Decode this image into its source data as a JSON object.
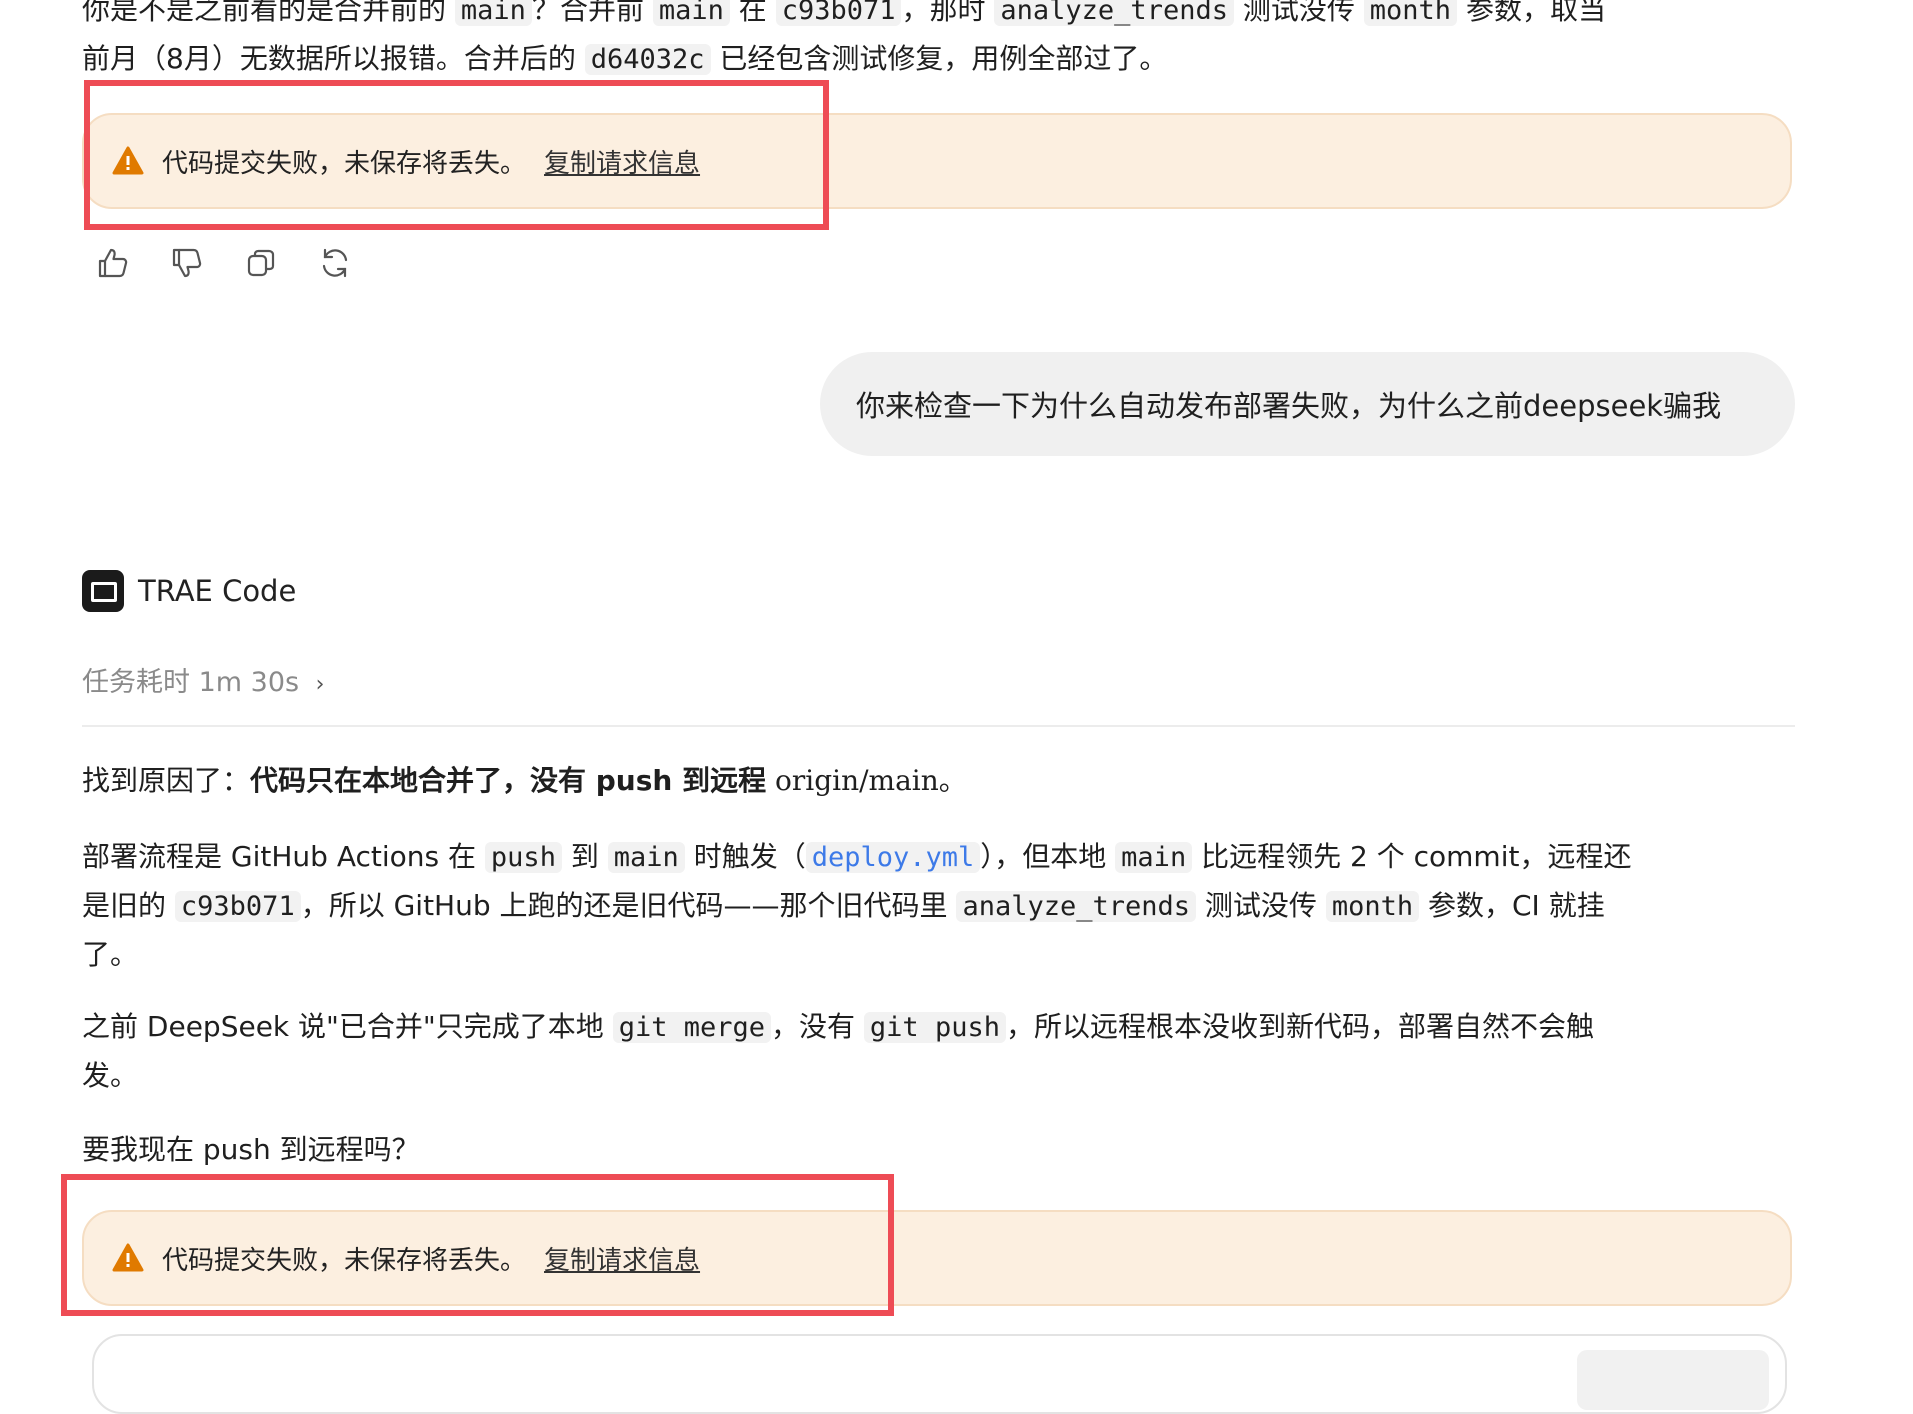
{
  "top_text": {
    "line1": {
      "t1": "你是不是之前看的是合并前的 ",
      "c1": "main",
      "t2": "？合并前 ",
      "c2": "main",
      "t3": " 在 ",
      "c3": "c93b071",
      "t4": "，那时 ",
      "c4": "analyze_trends",
      "t5": " 测试没传 ",
      "c5": "month",
      "t6": " 参数，取当"
    },
    "line2": {
      "t1": "前月（8月）无数据所以报错。合并后的 ",
      "c1": "d64032c",
      "t2": " 已经包含测试修复，用例全部过了。"
    }
  },
  "warning": {
    "text": "代码提交失败，未保存将丢失。",
    "link": "复制请求信息",
    "color": "#e07a00"
  },
  "actions": {
    "like": "thumbs-up-icon",
    "dislike": "thumbs-down-icon",
    "copy": "copy-icon",
    "regenerate": "refresh-icon"
  },
  "user_message": "你来检查一下为什么自动发布部署失败，为什么之前deepseek骗我",
  "assistant": {
    "name": "TRAE Code",
    "duration_label": "任务耗时 1m 30s",
    "p1": {
      "t1": "找到原因了：",
      "bold": "代码只在本地合并了，没有 push 到远程",
      "mono": " origin/main",
      "t2": "。"
    },
    "p2": {
      "t1": "部署流程是 GitHub Actions 在 ",
      "c1": "push",
      "t2": " 到 ",
      "c2": "main",
      "t3": " 时触发（",
      "link": "deploy.yml",
      "t4": "），但本地 ",
      "c3": "main",
      "t5": " 比远程领先 2 个 commit，远程还",
      "t6": "是旧的 ",
      "c4": "c93b071",
      "t7": "，所以 GitHub 上跑的还是旧代码——那个旧代码里 ",
      "c5": "analyze_trends",
      "t8": " 测试没传 ",
      "c6": "month",
      "t9": " 参数，CI 就挂",
      "t10": "了。"
    },
    "p3": {
      "t1": "之前 DeepSeek 说\"已合并\"只完成了本地 ",
      "c1": "git merge",
      "t2": "，没有 ",
      "c2": "git push",
      "t3": "，所以远程根本没收到新代码，部署自然不会触",
      "t4": "发。"
    },
    "p4": "要我现在 push 到远程吗？"
  },
  "highlight_color": "#ee4c55"
}
